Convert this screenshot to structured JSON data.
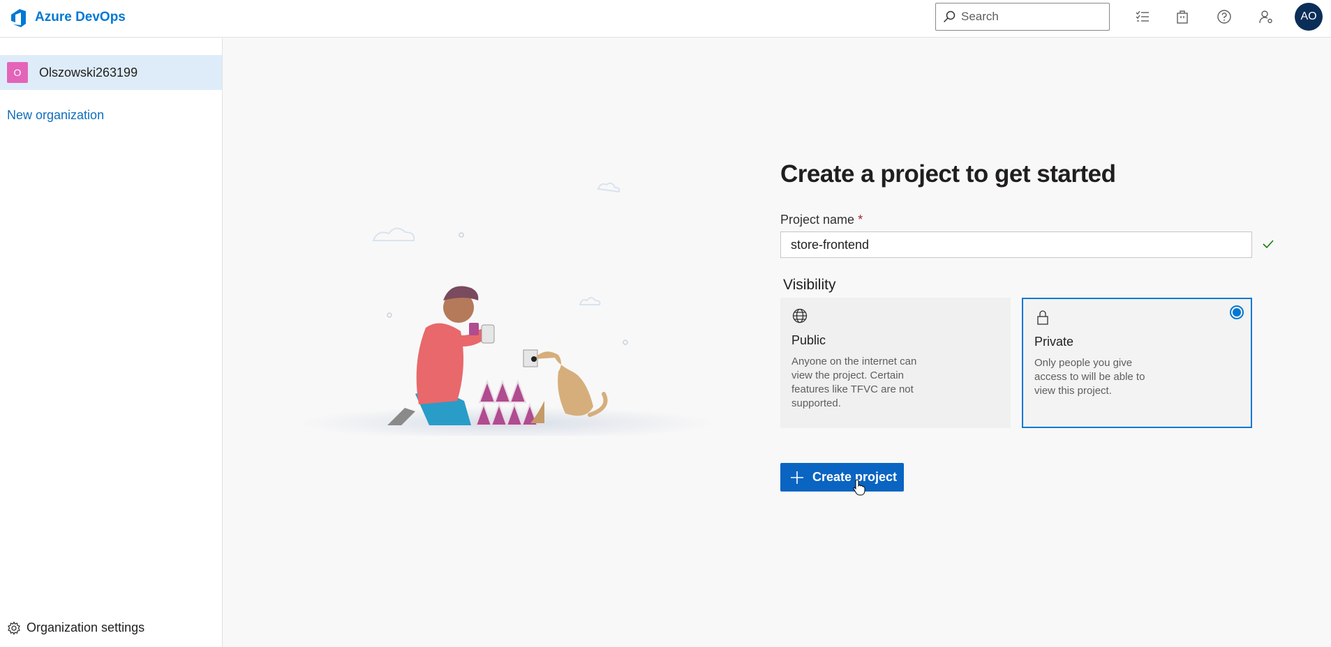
{
  "header": {
    "brand_name": "Azure DevOps",
    "brand_icon": "azure-devops-logo",
    "search_placeholder": "Search",
    "icons": [
      "work-items-icon",
      "marketplace-icon",
      "help-icon",
      "user-settings-icon"
    ],
    "avatar_initials": "AO",
    "accent_color": "#0078d4"
  },
  "sidebar": {
    "organization": {
      "badge": "O",
      "name": "Olszowski263199",
      "badge_color": "#e364b8"
    },
    "new_org_label": "New organization",
    "settings_label": "Organization settings"
  },
  "form": {
    "title": "Create a project to get started",
    "project_name_label": "Project name",
    "required_marker": "*",
    "project_name_value": "store-frontend",
    "visibility_label": "Visibility",
    "options": [
      {
        "title": "Public",
        "icon": "globe-icon",
        "description": "Anyone on the internet can view the project. Certain features like TFVC are not supported.",
        "selected": false
      },
      {
        "title": "Private",
        "icon": "lock-icon",
        "description": "Only people you give access to will be able to view this project.",
        "selected": true
      }
    ],
    "create_button_label": "Create project"
  }
}
